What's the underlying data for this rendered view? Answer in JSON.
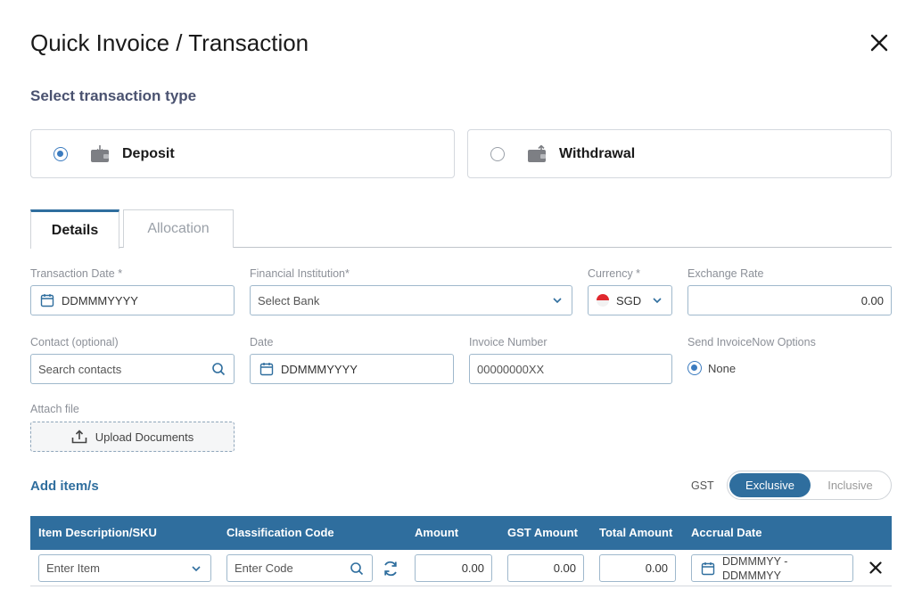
{
  "dialog": {
    "title": "Quick Invoice / Transaction"
  },
  "transaction_type": {
    "heading": "Select transaction type",
    "options": [
      {
        "label": "Deposit",
        "selected": true,
        "icon": "wallet-in-icon"
      },
      {
        "label": "Withdrawal",
        "selected": false,
        "icon": "wallet-out-icon"
      }
    ]
  },
  "tabs": [
    {
      "label": "Details",
      "active": true
    },
    {
      "label": "Allocation",
      "active": false
    }
  ],
  "form": {
    "transaction_date": {
      "label": "Transaction Date *",
      "value": "DDMMMYYYY"
    },
    "financial_institution": {
      "label": "Financial Institution*",
      "placeholder": "Select Bank"
    },
    "currency": {
      "label": "Currency  *",
      "value": "SGD"
    },
    "exchange_rate": {
      "label": "Exchange Rate",
      "value": "0.00"
    },
    "contact": {
      "label": "Contact (optional)",
      "placeholder": "Search contacts"
    },
    "date": {
      "label": "Date",
      "value": "DDMMMYYYY"
    },
    "invoice_number": {
      "label": "Invoice Number",
      "placeholder": "00000000XX"
    },
    "invoicenow": {
      "label": "Send InvoiceNow Options",
      "option": "None"
    },
    "attach": {
      "label": "Attach file",
      "button": "Upload Documents"
    }
  },
  "items": {
    "heading": "Add item/s",
    "gst_label": "GST",
    "gst_options": [
      "Exclusive",
      "Inclusive"
    ],
    "gst_selected": "Exclusive",
    "columns": [
      "Item Description/SKU",
      "Classification Code",
      "Amount",
      "GST Amount",
      "Total Amount",
      "Accrual Date"
    ],
    "row": {
      "item_placeholder": "Enter Item",
      "code_placeholder": "Enter Code",
      "amount": "0.00",
      "gst_amount": "0.00",
      "total_amount": "0.00",
      "accrual_line1": "DDMMMYY -",
      "accrual_line2": "DDMMMYY"
    }
  },
  "colors": {
    "primary": "#2f6e9e",
    "heading": "#4a5270",
    "radio": "#3b7bbf"
  }
}
